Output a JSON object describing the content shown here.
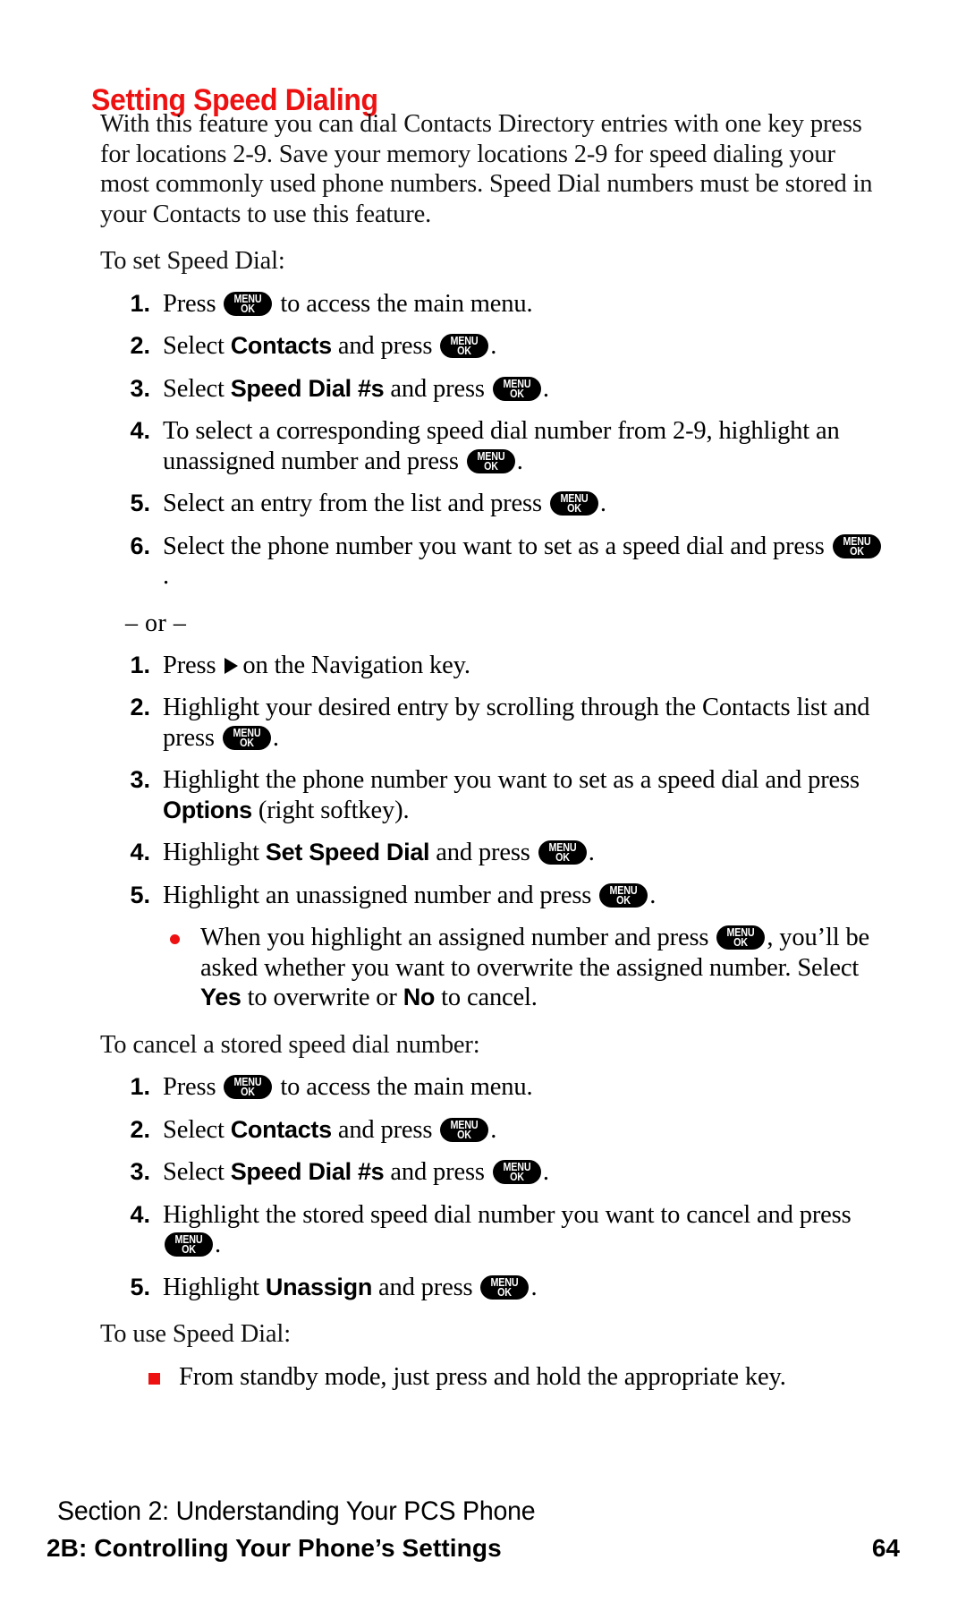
{
  "document": {
    "title": "Setting Speed Dialing",
    "title_color": "#ee1111",
    "accent_color": "#ee1111"
  },
  "intro": {
    "paragraph": "With this feature you can dial Contacts Directory entries with one key press for locations 2-9. Save your memory locations 2-9 for speed dialing your most commonly used phone numbers. Speed Dial numbers must be stored in your Contacts to use this feature."
  },
  "keys": {
    "menu_ok_line1": "MENU",
    "menu_ok_line2": "OK",
    "nav_arrow": "right-arrow"
  },
  "sections": {
    "set_speed_dial": {
      "lead": "To set Speed Dial:",
      "steps": [
        {
          "num": "1.",
          "parts": [
            {
              "t": "text",
              "v": "Press "
            },
            {
              "t": "key"
            },
            {
              "t": "text",
              "v": " to access the main menu."
            }
          ]
        },
        {
          "num": "2.",
          "parts": [
            {
              "t": "text",
              "v": "Select "
            },
            {
              "t": "ui",
              "v": "Contacts"
            },
            {
              "t": "text",
              "v": " and press "
            },
            {
              "t": "key"
            },
            {
              "t": "text",
              "v": "."
            }
          ]
        },
        {
          "num": "3.",
          "parts": [
            {
              "t": "text",
              "v": "Select "
            },
            {
              "t": "ui",
              "v": "Speed Dial #s"
            },
            {
              "t": "text",
              "v": " and press "
            },
            {
              "t": "key"
            },
            {
              "t": "text",
              "v": "."
            }
          ]
        },
        {
          "num": "4.",
          "parts": [
            {
              "t": "text",
              "v": "To select a corresponding speed dial number from 2-9, highlight an unassigned number and press "
            },
            {
              "t": "key"
            },
            {
              "t": "text",
              "v": "."
            }
          ]
        },
        {
          "num": "5.",
          "parts": [
            {
              "t": "text",
              "v": "Select an entry from the list and press "
            },
            {
              "t": "key"
            },
            {
              "t": "text",
              "v": "."
            }
          ]
        },
        {
          "num": "6.",
          "parts": [
            {
              "t": "text",
              "v": "Select the phone number you want to set as a speed dial and press "
            },
            {
              "t": "key"
            },
            {
              "t": "text",
              "v": "."
            }
          ]
        }
      ]
    },
    "or_separator": "– or –",
    "alternate_method": {
      "steps": [
        {
          "num": "1.",
          "parts": [
            {
              "t": "text",
              "v": "Press "
            },
            {
              "t": "arrow"
            },
            {
              "t": "text",
              "v": "on the Navigation key."
            }
          ]
        },
        {
          "num": "2.",
          "parts": [
            {
              "t": "text",
              "v": "Highlight your desired entry by scrolling through the Contacts list and press "
            },
            {
              "t": "key"
            },
            {
              "t": "text",
              "v": "."
            }
          ]
        },
        {
          "num": "3.",
          "parts": [
            {
              "t": "text",
              "v": "Highlight the phone number you want to set as a speed dial and press "
            },
            {
              "t": "ui",
              "v": "Options"
            },
            {
              "t": "text",
              "v": " (right softkey)."
            }
          ]
        },
        {
          "num": "4.",
          "parts": [
            {
              "t": "text",
              "v": "Highlight "
            },
            {
              "t": "ui",
              "v": "Set Speed Dial"
            },
            {
              "t": "text",
              "v": " and press "
            },
            {
              "t": "key"
            },
            {
              "t": "text",
              "v": "."
            }
          ]
        },
        {
          "num": "5.",
          "parts": [
            {
              "t": "text",
              "v": "Highlight an unassigned number and press "
            },
            {
              "t": "key"
            },
            {
              "t": "text",
              "v": "."
            }
          ]
        }
      ],
      "note": {
        "bullet": "red-dot",
        "parts": [
          {
            "t": "text",
            "v": "When you highlight an assigned number and press "
          },
          {
            "t": "key"
          },
          {
            "t": "text",
            "v": ", you’ll be asked whether you want to overwrite the assigned number. Select "
          },
          {
            "t": "ui",
            "v": "Yes"
          },
          {
            "t": "text",
            "v": " to overwrite or "
          },
          {
            "t": "ui",
            "v": "No"
          },
          {
            "t": "text",
            "v": " to cancel."
          }
        ]
      }
    },
    "cancel_speed_dial": {
      "lead": "To cancel a stored speed dial number:",
      "steps": [
        {
          "num": "1.",
          "parts": [
            {
              "t": "text",
              "v": "Press "
            },
            {
              "t": "key"
            },
            {
              "t": "text",
              "v": " to access the main menu."
            }
          ]
        },
        {
          "num": "2.",
          "parts": [
            {
              "t": "text",
              "v": "Select "
            },
            {
              "t": "ui",
              "v": "Contacts"
            },
            {
              "t": "text",
              "v": " and press "
            },
            {
              "t": "key"
            },
            {
              "t": "text",
              "v": "."
            }
          ]
        },
        {
          "num": "3.",
          "parts": [
            {
              "t": "text",
              "v": "Select "
            },
            {
              "t": "ui",
              "v": "Speed Dial #s"
            },
            {
              "t": "text",
              "v": " and press "
            },
            {
              "t": "key"
            },
            {
              "t": "text",
              "v": "."
            }
          ]
        },
        {
          "num": "4.",
          "parts": [
            {
              "t": "text",
              "v": "Highlight the stored speed dial number you want to cancel and press "
            },
            {
              "t": "key"
            },
            {
              "t": "text",
              "v": "."
            }
          ]
        },
        {
          "num": "5.",
          "parts": [
            {
              "t": "text",
              "v": "Highlight "
            },
            {
              "t": "ui",
              "v": "Unassign"
            },
            {
              "t": "text",
              "v": " and press "
            },
            {
              "t": "key"
            },
            {
              "t": "text",
              "v": "."
            }
          ]
        }
      ]
    },
    "use_speed_dial": {
      "lead": "To use Speed Dial:",
      "bullet_type": "red-square",
      "bullet_text": "From standby mode, just press and hold the appropriate key."
    }
  },
  "footer": {
    "section_line": "Section 2: Understanding Your PCS Phone",
    "chapter_line": "2B: Controlling Your Phone’s Settings",
    "page_number": "64"
  }
}
